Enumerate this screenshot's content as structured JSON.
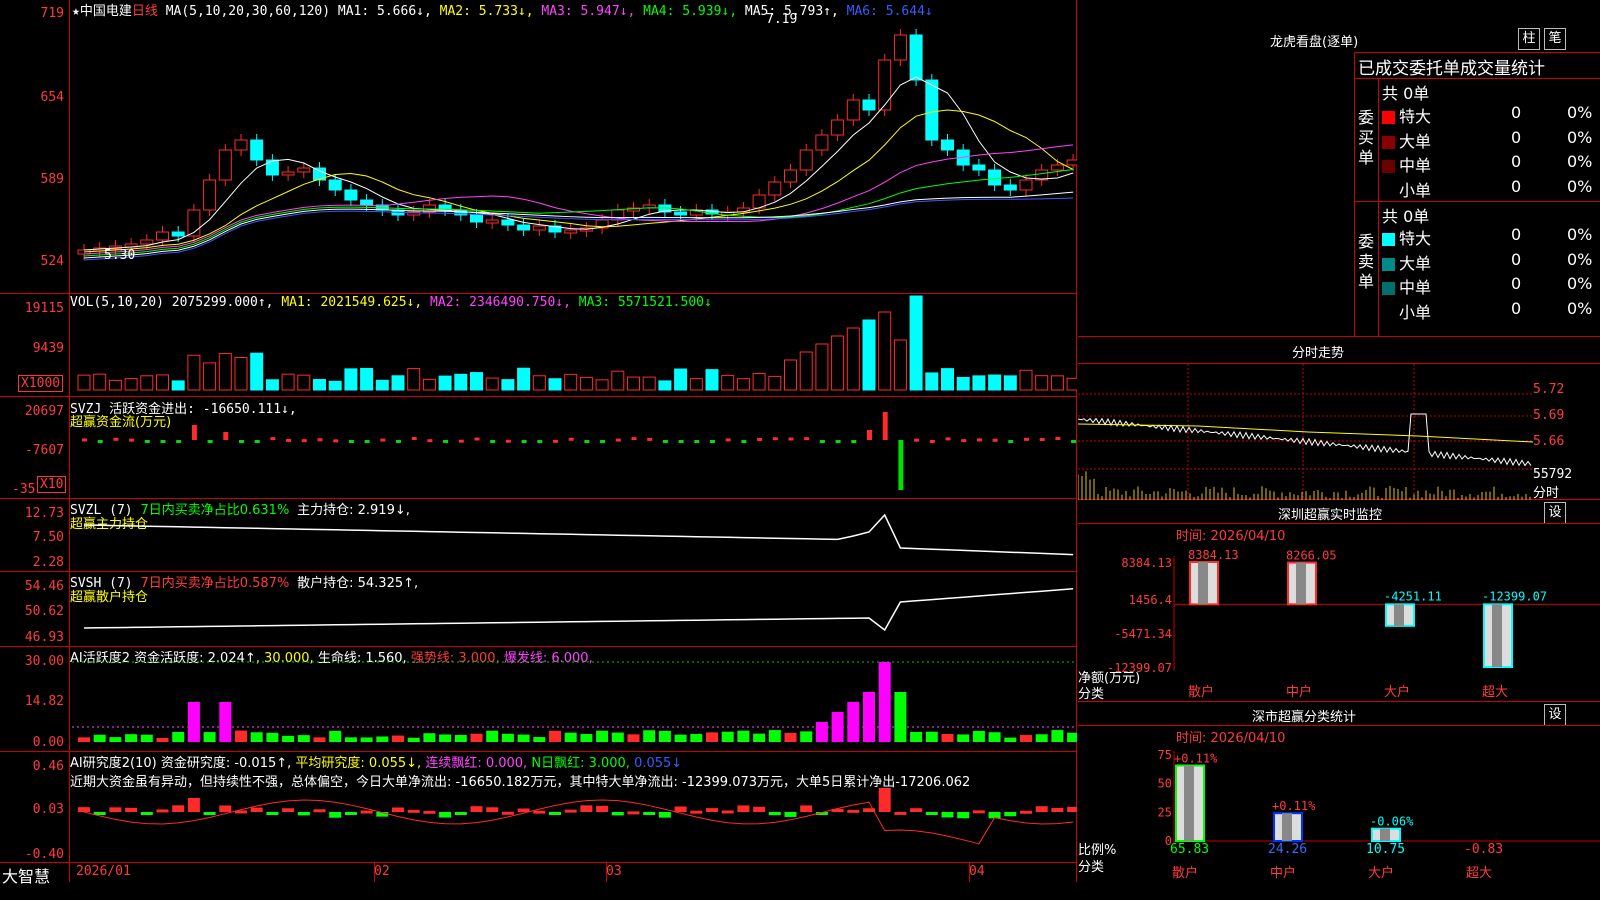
{
  "main": {
    "title_star": "★",
    "stock_name": "中国电建",
    "period": "日线",
    "ma_label": "MA(5,10,20,30,60,120)",
    "ma1": "MA1: 5.666↓,",
    "ma2": "MA2: 5.733↓,",
    "ma3": "MA3: 5.947↓,",
    "ma4": "MA4: 5.939↓,",
    "ma5": "MA5: 5.793↑,",
    "ma6": "MA6: 5.644↓",
    "y_ticks": [
      "719",
      "654",
      "589",
      "524"
    ],
    "high_mark": "7.19",
    "low_mark": "5.30"
  },
  "vol": {
    "label": "VOL(5,10,20)",
    "value": "2075299.000↑,",
    "ma1": "MA1: 2021549.625↓,",
    "ma2": "MA2: 2346490.750↓,",
    "ma3": "MA3: 5571521.500↓",
    "y_ticks": [
      "19115",
      "9439"
    ],
    "unit": "X1000"
  },
  "svzj": {
    "label": "SVZJ  活跃资金进出: -16650.111↓,",
    "sub": "超赢资金流(万元)",
    "y_ticks": [
      "20697",
      "-7607",
      "-35"
    ],
    "unit": "X10"
  },
  "svzl": {
    "label1": "SVZL (7)",
    "label2": "7日内买卖净占比0.631%",
    "label3": "主力持仓: 2.919↓,",
    "sub": "超赢主力持仓",
    "y_ticks": [
      "12.73",
      "7.50",
      "2.28"
    ]
  },
  "svsh": {
    "label1": "SVSH (7)",
    "label2": "7日内买卖净占比0.587%",
    "label3": "散户持仓: 54.325↑,",
    "sub": "超赢散户持仓",
    "y_ticks": [
      "54.46",
      "50.62",
      "46.93"
    ]
  },
  "ai_act": {
    "label1": "AI活跃度2",
    "label2": "资金活跃度: 2.024↑,",
    "label3": "30.000,",
    "label4": "生命线: 1.560,",
    "label5": "强势线: 3.000,",
    "label6": "爆发线: 6.000,",
    "y_ticks": [
      "30.00",
      "14.82",
      "0.00"
    ]
  },
  "ai_res": {
    "label1": "AI研究度2(10)",
    "label2": "资金研究度: -0.015↑,",
    "label3": "平均研究度: 0.055↓,",
    "label4": "连续飘红: 0.000,",
    "label5": "N日飘红: 3.000,",
    "label6": "0.055↓",
    "comment": "近期大资金虽有异动，但持续性不强，总体偏空，今日大单净流出: -16650.182万元，其中特大单净流出: -12399.073万元，大单5日累计净出-17206.062",
    "y_ticks": [
      "0.46",
      "0.03",
      "-0.40"
    ]
  },
  "xaxis": {
    "brand": "大智慧",
    "labels": [
      "2026/01",
      "02",
      "03",
      "04"
    ]
  },
  "lhb": {
    "title": "龙虎看盘(逐单)",
    "btn_zhu": "柱",
    "btn_bi": "笔",
    "header": "已成交委托单成交量统计",
    "buy_side": "委买单",
    "sell_side": "委卖单",
    "buy_total": "共 0单",
    "sell_total": "共 0单",
    "buy_rows": [
      {
        "name": "特大",
        "count": "0",
        "pct": "0%",
        "color": "#ff0000"
      },
      {
        "name": "大单",
        "count": "0",
        "pct": "0%",
        "color": "#8b0000"
      },
      {
        "name": "中单",
        "count": "0",
        "pct": "0%",
        "color": "#6a0000"
      },
      {
        "name": "小单",
        "count": "0",
        "pct": "0%",
        "color": "#000000"
      }
    ],
    "sell_rows": [
      {
        "name": "特大",
        "count": "0",
        "pct": "0%",
        "color": "#00ffff"
      },
      {
        "name": "大单",
        "count": "0",
        "pct": "0%",
        "color": "#008b8b"
      },
      {
        "name": "中单",
        "count": "0",
        "pct": "0%",
        "color": "#006f6f"
      },
      {
        "name": "小单",
        "count": "0",
        "pct": "0%",
        "color": "#000000"
      }
    ]
  },
  "fenshi": {
    "title": "分时走势",
    "y_ticks": [
      "5.72",
      "5.69",
      "5.66"
    ],
    "vol_tick": "55792",
    "unit": "分时"
  },
  "monitor": {
    "title": "深圳超赢实时监控",
    "btn": "设",
    "time": "时间: 2026/04/10",
    "y_ticks": [
      "8384.13",
      "1456.4",
      "-5471.34",
      "-12399.07"
    ],
    "y_unit1": "净额(万元)",
    "y_unit2": "分类",
    "bars": [
      {
        "cat": "散户",
        "value": 8384.13,
        "label": "8384.13"
      },
      {
        "cat": "中户",
        "value": 8266.05,
        "label": "8266.05"
      },
      {
        "cat": "大户",
        "value": -4251.11,
        "label": "-4251.11"
      },
      {
        "cat": "超大",
        "value": -12399.07,
        "label": "-12399.07"
      }
    ]
  },
  "classify": {
    "title": "深市超赢分类统计",
    "btn": "设",
    "time": "时间: 2026/04/10",
    "y_ticks": [
      "75",
      "50",
      "25",
      "0"
    ],
    "y_unit1": "比例%",
    "y_unit2": "分类",
    "bars": [
      {
        "cat": "散户",
        "value": 65.83,
        "delta": "+0.11%",
        "label": "65.83"
      },
      {
        "cat": "中户",
        "value": 24.26,
        "delta": "+0.11%",
        "label": "24.26"
      },
      {
        "cat": "大户",
        "value": 10.75,
        "delta": "-0.06%",
        "label": "10.75"
      },
      {
        "cat": "超大",
        "value": 0,
        "delta": "",
        "label": "-0.83"
      }
    ]
  },
  "chart_data": {
    "type": "bar",
    "title": "深圳超赢实时监控",
    "categories": [
      "散户",
      "中户",
      "大户",
      "超大"
    ],
    "values": [
      8384.13,
      8266.05,
      -4251.11,
      -12399.07
    ],
    "ylabel": "净额(万元)",
    "ylim": [
      -12399.07,
      8384.13
    ]
  }
}
